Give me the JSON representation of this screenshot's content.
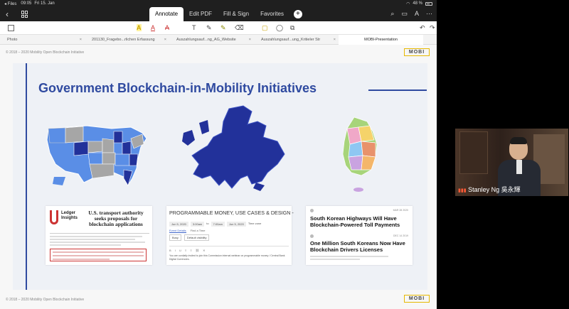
{
  "status_bar": {
    "left": "◂ Files",
    "time": "09:05",
    "date": "Fri 15. Jan",
    "battery": "48 %"
  },
  "top_tabs": [
    "Annotate",
    "Edit PDF",
    "Fill & Sign",
    "Favorites"
  ],
  "add_tab": "+",
  "doc_tabs": [
    "Photo",
    "201130_Fragebo...rlichen Erfassung",
    "Auszahlungsauf...ng_AG_Website",
    "Auszahlungsauf...ung_Kritieler Str",
    "MOBI-Presentation"
  ],
  "doc": {
    "header_copyright": "© 2018 – 2020 Mobility Open Blockchain Initiative",
    "footer_copyright": "© 2018 – 2020 Mobility Open Blockchain Initiative",
    "logo": "MOBI"
  },
  "slide": {
    "title": "Government Blockchain-in-Mobility Initiatives",
    "ledger_card": {
      "brand_line1": "Ledger",
      "brand_line2": "Insights",
      "headline": "U.S. transport authority seeks proposals for blockchain applications"
    },
    "money_card": {
      "title": "PROGRAMMABLE MONEY, USE CASES & DESIGN -",
      "fields": [
        "Jun 5, 2020",
        "3:00am",
        "to",
        "7:00am",
        "Jun 5, 2020",
        "Time zone"
      ],
      "subtabs": [
        "Event Details",
        "Find a Time"
      ],
      "selects": [
        "Busy",
        "Default visibility"
      ],
      "note": "You are cordially invited to join this Commission internal webinar on programmable money / Central Bank Digital Currencies."
    },
    "news_card": {
      "date1": "MAR 28 2020",
      "headline1": "South Korean Highways Will Have Blockchain-Powered Toll Payments",
      "date2": "DEC 14 2019",
      "headline2": "One Million South Koreans Now Have Blockchain Drivers Licenses"
    }
  },
  "video": {
    "name": "Stanley Ng 吳永輝"
  },
  "colors": {
    "title_blue": "#2f4aa0",
    "map_dark_blue": "#22319a",
    "map_light_blue": "#5a8ee6",
    "logo_border": "#e6b800"
  }
}
